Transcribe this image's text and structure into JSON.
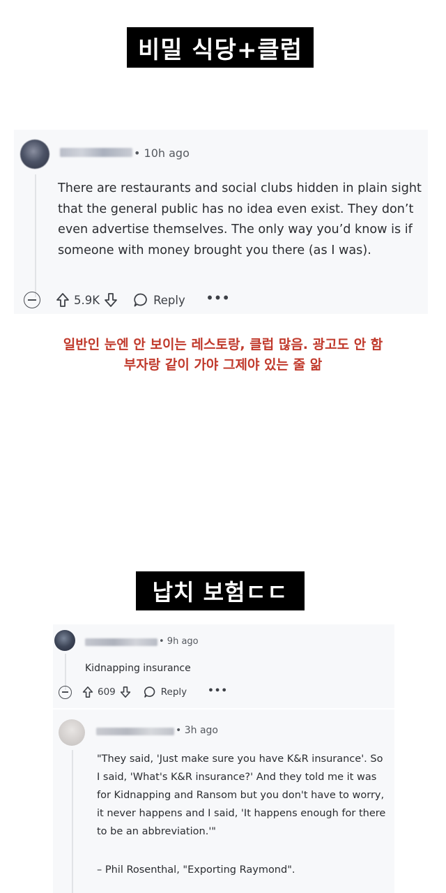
{
  "section1": {
    "banner": "비밀 식당+클럽",
    "comment": {
      "time": "• 10h ago",
      "body": "There are restaurants and social clubs hidden in plain sight that the general public has no idea even exist. They don’t even advertise themselves. The only way you’d know is if someone with money brought you there (as I was).",
      "score": "5.9K",
      "reply_label": "Reply",
      "more": "•••"
    },
    "caption_line1": "일반인 눈엔 안 보이는 레스토랑, 클럽 많음. 광고도 안 함",
    "caption_line2": "부자랑 같이 가야 그제야 있는 줄 앎"
  },
  "section2": {
    "banner": "납치 보험ㄷㄷ",
    "comment": {
      "time": "• 9h ago",
      "body": "Kidnapping insurance",
      "score": "609",
      "reply_label": "Reply",
      "more": "•••"
    },
    "reply": {
      "time": "• 3h ago",
      "body": "\"They said, 'Just make sure you have K&R insurance'. So I said, 'What's K&R insurance?' And they told me it was for Kidnapping and Ransom but you don't have to worry, it never happens and I said, 'It happens enough for there to be an abbreviation.'\"",
      "attribution": "– Phil Rosenthal, \"Exporting Raymond\"."
    }
  },
  "icons": {
    "collapse": "collapse-icon",
    "upvote": "upvote-arrow-icon",
    "downvote": "downvote-arrow-icon",
    "reply": "speech-bubble-icon",
    "more": "more-options-icon"
  },
  "colors": {
    "caption": "#c0392b",
    "card_bg": "#f7f8fa",
    "banner_bg": "#000000"
  }
}
